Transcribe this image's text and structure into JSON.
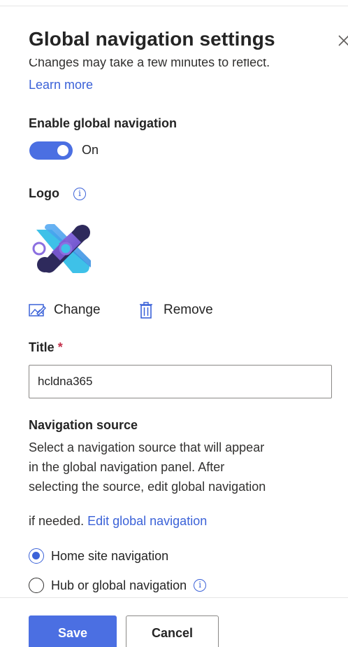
{
  "panel": {
    "title": "Global navigation settings",
    "description": "Changes may take a few minutes to reflect.",
    "learn_more": "Learn more"
  },
  "global_nav": {
    "label": "Enable global navigation",
    "toggle_state": "On",
    "enabled": true
  },
  "logo": {
    "label": "Logo",
    "info_glyph": "i",
    "change_label": "Change",
    "remove_label": "Remove"
  },
  "title_field": {
    "label": "Title",
    "required_marker": "*",
    "value": "hcldna365"
  },
  "nav_source": {
    "label": "Navigation source",
    "help_line1": "Select a navigation source that will appear",
    "help_line2": "in the global navigation panel. After",
    "help_line3": "selecting the source, edit global navigation",
    "help_line4": "if needed.",
    "edit_link": "Edit global navigation",
    "options": [
      {
        "label": "Home site navigation",
        "checked": true
      },
      {
        "label": "Hub or global navigation",
        "checked": false
      }
    ]
  },
  "footer": {
    "save_label": "Save",
    "cancel_label": "Cancel"
  },
  "colors": {
    "accent": "#4b6fe2",
    "link": "#3b62d8",
    "required": "#c4314b"
  }
}
